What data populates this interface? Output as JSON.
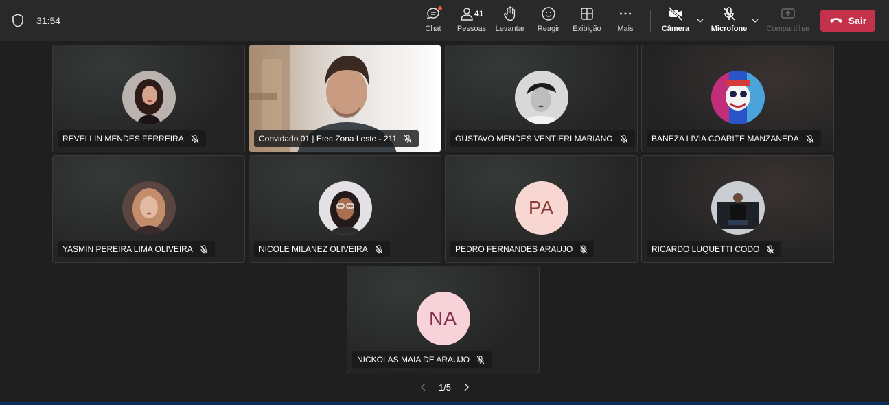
{
  "meeting": {
    "timer": "31:54"
  },
  "toolbar": {
    "chat": "Chat",
    "people": "Pessoas",
    "people_count": "41",
    "raise": "Levantar",
    "react": "Reagir",
    "view": "Exibição",
    "more": "Mais",
    "camera": "Câmera",
    "mic": "Microfone",
    "share": "Compartilhar",
    "leave": "Sair"
  },
  "participants": [
    {
      "name": "REVELLIN MENDES FERREIRA",
      "muted": true
    },
    {
      "name": "Convidado 01 | Etec Zona Leste - 211",
      "muted": true
    },
    {
      "name": "GUSTAVO MENDES VENTIERI MARIANO",
      "muted": true
    },
    {
      "name": "BANEZA LIVIA COARITE MANZANEDA",
      "muted": true
    },
    {
      "name": "YASMIN PEREIRA LIMA OLIVEIRA",
      "muted": true
    },
    {
      "name": "NICOLE MILANEZ OLIVEIRA",
      "muted": true
    },
    {
      "name": "PEDRO FERNANDES ARAUJO",
      "initials": "PA",
      "muted": true
    },
    {
      "name": "RICARDO LUQUETTI CODO",
      "muted": true
    },
    {
      "name": "NICKOLAS MAIA DE ARAUJO",
      "initials": "NA",
      "muted": true
    }
  ],
  "pager": {
    "label": "1/5"
  },
  "colors": {
    "leave": "#c4314b",
    "topbar": "#292929",
    "background": "#1f1f1f",
    "chat_dot": "#f0593e"
  }
}
